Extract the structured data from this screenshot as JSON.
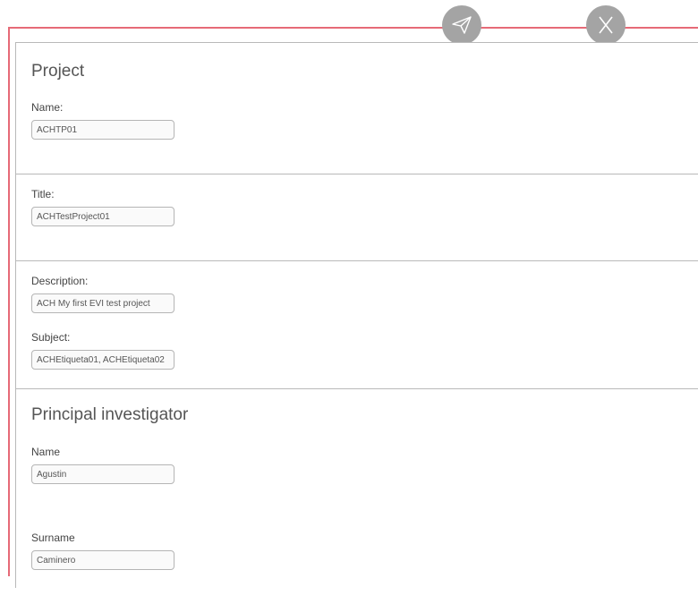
{
  "toolbar": {
    "send_icon": "paper-plane-icon",
    "close_icon": "close-x-icon",
    "accent_color": "#e66a77",
    "button_color": "#a4a4a4"
  },
  "project": {
    "heading": "Project",
    "name_label": "Name:",
    "name_value": "ACHTP01"
  },
  "title_section": {
    "title_label": "Title:",
    "title_value": "ACHTestProject01"
  },
  "description_section": {
    "description_label": "Description:",
    "description_value": "ACH My first EVI test project",
    "subject_label": "Subject:",
    "subject_value": "ACHEtiqueta01, ACHEtiqueta02"
  },
  "investigator": {
    "heading": "Principal investigator",
    "name_label": "Name",
    "name_value": "Agustin",
    "surname_label": "Surname",
    "surname_value": "Caminero"
  }
}
